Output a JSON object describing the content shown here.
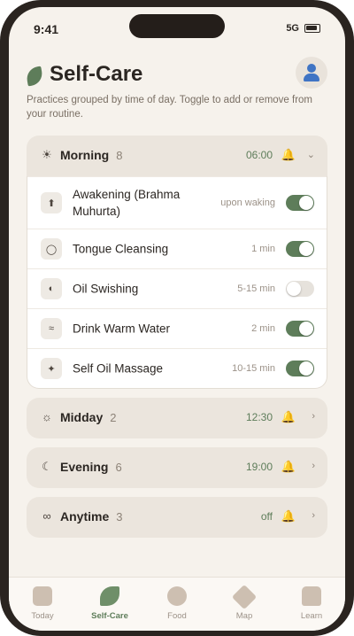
{
  "status_bar": {
    "time": "9:41",
    "network": "5G"
  },
  "header": {
    "title": "Self-Care"
  },
  "subtitle": "Practices grouped by time of day. Toggle to add or remove from your routine.",
  "sections": [
    {
      "name": "Morning",
      "count": "8",
      "time": "06:00",
      "icon": "sun-icon",
      "expanded": true,
      "practices": [
        {
          "name": "Awakening (Brahma Muhurta)",
          "duration": "upon waking",
          "icon": "arrow-up-icon",
          "enabled": true
        },
        {
          "name": "Tongue Cleansing",
          "duration": "1 min",
          "icon": "circle-icon",
          "enabled": true
        },
        {
          "name": "Oil Swishing",
          "duration": "5-15 min",
          "icon": "half-circle-icon",
          "enabled": false
        },
        {
          "name": "Drink Warm Water",
          "duration": "2 min",
          "icon": "waves-icon",
          "enabled": true
        },
        {
          "name": "Self Oil Massage",
          "duration": "10-15 min",
          "icon": "sparkle-icon",
          "enabled": true
        }
      ]
    },
    {
      "name": "Midday",
      "count": "2",
      "time": "12:30",
      "icon": "sun-outline-icon",
      "expanded": false
    },
    {
      "name": "Evening",
      "count": "6",
      "time": "19:00",
      "icon": "moon-icon",
      "expanded": false
    },
    {
      "name": "Anytime",
      "count": "3",
      "time": "off",
      "icon": "infinity-icon",
      "expanded": false
    }
  ],
  "nav": {
    "active": "Self-Care",
    "items": [
      {
        "label": "Today",
        "icon": "today-icon"
      },
      {
        "label": "Self-Care",
        "icon": "leaf-icon"
      },
      {
        "label": "Food",
        "icon": "food-icon"
      },
      {
        "label": "Map",
        "icon": "map-icon"
      },
      {
        "label": "Learn",
        "icon": "learn-icon"
      }
    ]
  },
  "colors": {
    "accent": "#5e7d5a",
    "bell": "#d9a21a",
    "background": "#f6f2ec"
  }
}
